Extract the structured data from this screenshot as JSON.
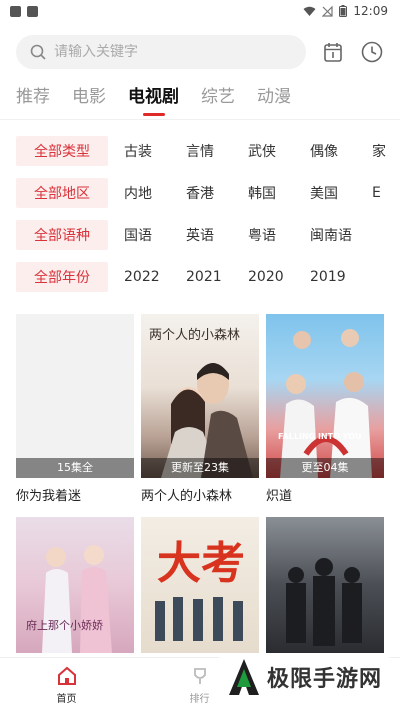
{
  "status": {
    "time": "12:09"
  },
  "search": {
    "placeholder": "请输入关键字"
  },
  "tabs": [
    {
      "label": "推荐"
    },
    {
      "label": "电影"
    },
    {
      "label": "电视剧"
    },
    {
      "label": "综艺"
    },
    {
      "label": "动漫"
    }
  ],
  "filters": [
    {
      "chip": "全部类型",
      "options": [
        "古装",
        "言情",
        "武侠",
        "偶像",
        "家"
      ]
    },
    {
      "chip": "全部地区",
      "options": [
        "内地",
        "香港",
        "韩国",
        "美国",
        "E"
      ]
    },
    {
      "chip": "全部语种",
      "options": [
        "国语",
        "英语",
        "粤语",
        "闽南语"
      ]
    },
    {
      "chip": "全部年份",
      "options": [
        "2022",
        "2021",
        "2020",
        "2019"
      ]
    }
  ],
  "cards": [
    {
      "title": "你为我着迷",
      "badge": "15集全"
    },
    {
      "title": "两个人的小森林",
      "badge": "更新至23集"
    },
    {
      "title": "炽道",
      "badge": "更至04集"
    },
    {
      "title": "",
      "badge": ""
    },
    {
      "title": "",
      "badge": ""
    },
    {
      "title": "",
      "badge": ""
    }
  ],
  "poster_text": {
    "p2": "两个人的小森林",
    "p3": "FALLING INTO YOU",
    "p4": "府上那个小娇娇",
    "p5": "大考"
  },
  "bottomnav": [
    {
      "label": "首页"
    },
    {
      "label": "排行"
    }
  ],
  "watermark": {
    "text": "极限手游网"
  },
  "colors": {
    "accent": "#d8333a",
    "chip_bg": "#fdeeee"
  }
}
